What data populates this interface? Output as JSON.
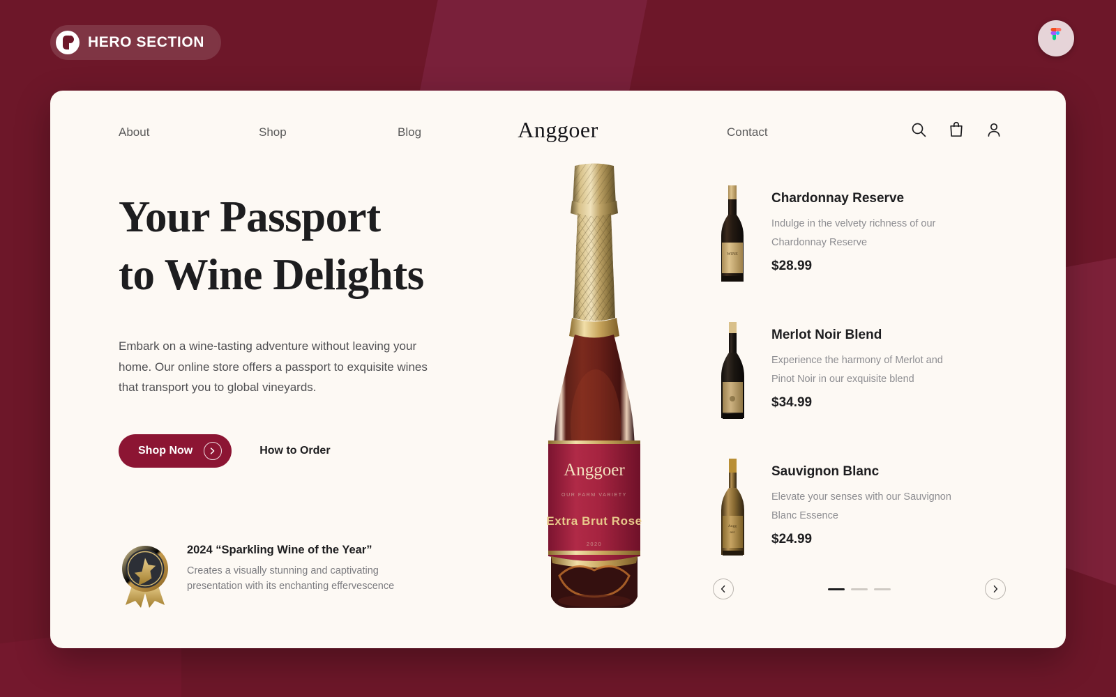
{
  "overlay": {
    "badge_label": "HERO SECTION",
    "badge_logo_icon": "product-logo-icon",
    "figma_icon": "figma-icon"
  },
  "colors": {
    "page_background": "#6d1729",
    "card_background": "#fdf9f4",
    "accent": "#8c1533",
    "text_primary": "#1d1d1f",
    "text_muted": "#8d8d91"
  },
  "nav": {
    "brand": "Anggoer",
    "links": [
      {
        "label": "About"
      },
      {
        "label": "Shop"
      },
      {
        "label": "Blog"
      },
      {
        "label": "Contact"
      }
    ],
    "icons": [
      {
        "name": "search-icon"
      },
      {
        "name": "shopping-bag-icon"
      },
      {
        "name": "user-account-icon"
      }
    ]
  },
  "hero": {
    "headline_line1": "Your Passport",
    "headline_line2": "to Wine Delights",
    "subcopy": "Embark on a wine-tasting adventure without leaving your home. Our online store offers a passport to exquisite wines that transport you to global vineyards.",
    "primary_cta": "Shop Now",
    "secondary_cta": "How to Order"
  },
  "award": {
    "icon": "award-medal-icon",
    "title": "2024 “Sparkling Wine of the Year”",
    "description": "Creates a visually stunning and captivating presentation with its enchanting effervescence"
  },
  "bottle": {
    "brand": "Anggoer",
    "subtitle": "OUR FARM VARIETY",
    "variant": "Extra Brut Rose",
    "year": "2020"
  },
  "products": [
    {
      "name": "Chardonnay Reserve",
      "description": "Indulge in the velvety richness of our Chardonnay Reserve",
      "price": "$28.99",
      "thumb": "wine-bottle-chardonnay-icon"
    },
    {
      "name": "Merlot Noir Blend",
      "description": "Experience the harmony of Merlot and Pinot Noir in our exquisite blend",
      "price": "$34.99",
      "thumb": "wine-bottle-merlot-icon"
    },
    {
      "name": "Sauvignon Blanc",
      "description": "Elevate your senses with our Sauvignon Blanc Essence",
      "price": "$24.99",
      "thumb": "wine-bottle-sauvignon-icon"
    }
  ],
  "carousel": {
    "prev_icon": "chevron-left-icon",
    "next_icon": "chevron-right-icon",
    "total_slides": 3,
    "active_slide": 1
  }
}
